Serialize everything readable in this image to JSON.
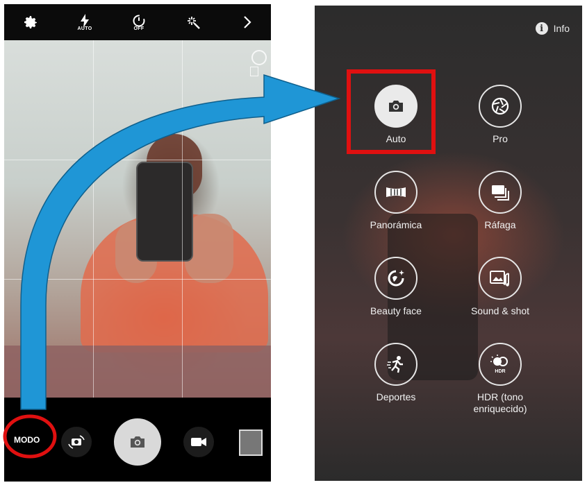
{
  "left_phone": {
    "top_bar": {
      "flash_sub": "AUTO",
      "timer_sub": "OFF"
    },
    "bottom_bar": {
      "mode_label": "MODO"
    }
  },
  "right_phone": {
    "info_label": "Info",
    "modes": [
      {
        "label": "Auto",
        "icon": "camera-icon",
        "selected": true
      },
      {
        "label": "Pro",
        "icon": "aperture-icon"
      },
      {
        "label": "Panorámica",
        "icon": "panorama-icon"
      },
      {
        "label": "Ráfaga",
        "icon": "burst-icon"
      },
      {
        "label": "Beauty face",
        "icon": "beauty-face-icon"
      },
      {
        "label": "Sound & shot",
        "icon": "sound-shot-icon"
      },
      {
        "label": "Deportes",
        "icon": "sports-icon"
      },
      {
        "label": "HDR (tono enriquecido)",
        "icon": "hdr-icon"
      }
    ]
  },
  "colors": {
    "arrow": "#1f96d6",
    "highlight": "#e01010",
    "shutter": "#d9d9d9"
  }
}
